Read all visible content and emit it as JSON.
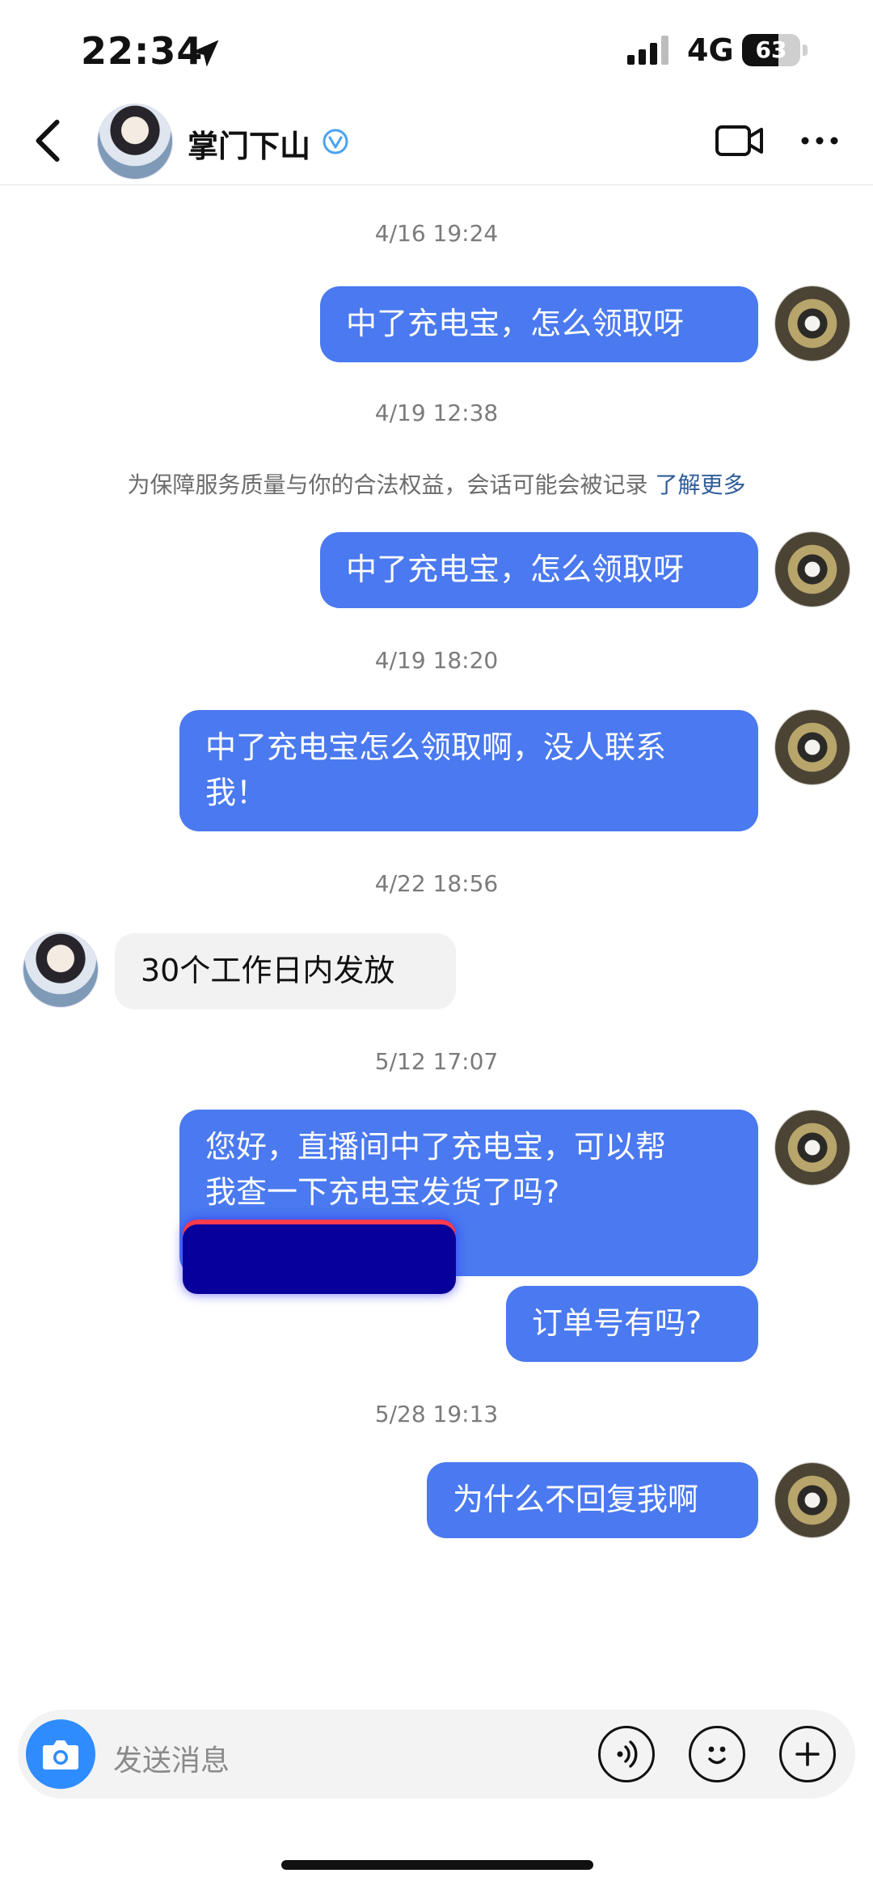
{
  "status_bar": {
    "time": "22:34",
    "network": "4G",
    "battery": "63",
    "battery_level": 0.63,
    "icons": [
      "location-arrow-icon",
      "signal-bars-icon",
      "battery-icon"
    ]
  },
  "header": {
    "contact_name": "掌门下山",
    "icons": [
      "back-icon",
      "verified-badge-icon",
      "video-call-icon",
      "more-icon"
    ]
  },
  "messages": {
    "ts1": "4/16 19:24",
    "m1": "中了充电宝，怎么领取呀",
    "ts2": "4/19 12:38",
    "notice": "为保障服务质量与你的合法权益，会话可能会被记录",
    "notice_link": "了解更多",
    "m2": "中了充电宝，怎么领取呀",
    "ts3": "4/19 18:20",
    "m3_line1": "中了充电宝怎么领取啊，没人联系",
    "m3_line2": "我！",
    "ts4": "4/22 18:56",
    "m4": "30个工作日内发放",
    "ts5": "5/12 17:07",
    "m5_line1": "您好，直播间中了充电宝，可以帮",
    "m5_line2": "我查一下充电宝发货了吗?",
    "m6": "订单号有吗?",
    "ts6": "5/28 19:13",
    "m7": "为什么不回复我啊"
  },
  "input": {
    "placeholder": "发送消息",
    "icons": [
      "camera-icon",
      "voice-icon",
      "emoji-icon",
      "plus-icon"
    ]
  },
  "colors": {
    "bubble_out": "#4a79f0",
    "bubble_in": "#f2f2f2",
    "link": "#2f5d9a",
    "camera": "#2f8cff"
  }
}
